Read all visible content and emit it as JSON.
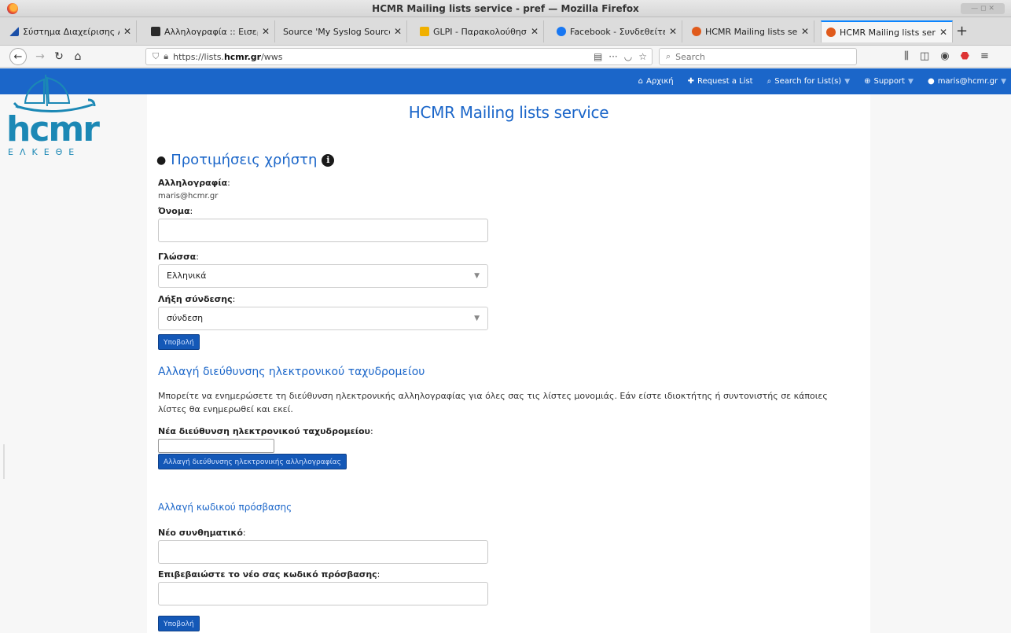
{
  "window": {
    "title": "HCMR Mailing lists service - pref — Mozilla Firefox"
  },
  "tabs": [
    {
      "label": "Σύστημα Διαχείρισης Ανθρώ",
      "fav_color": "#1b4fa8"
    },
    {
      "label": "Αλληλογραφία :: Εισερχόμενα",
      "fav_color": "#2b2b2b"
    },
    {
      "label": "Source 'My Syslog Source' :: Adis",
      "fav_color": "#888888"
    },
    {
      "label": "GLPI - Παρακολούθηση αιτήμ",
      "fav_color": "#f0b000"
    },
    {
      "label": "Facebook - Συνδεθείτε ή δημ",
      "fav_color": "#1877f2"
    },
    {
      "label": "HCMR Mailing lists service - p",
      "fav_color": "#e05a1b"
    },
    {
      "label": "HCMR Mailing lists service - p",
      "fav_color": "#e05a1b"
    }
  ],
  "navbar": {
    "url_prefix": "https://lists.",
    "url_host": "hcmr.gr",
    "url_path": "/wws",
    "search_placeholder": "Search"
  },
  "topnav": {
    "home": "Αρχική",
    "request": "Request a List",
    "search": "Search for List(s)",
    "support": "Support",
    "user": "maris@hcmr.gr"
  },
  "logo": {
    "word": "hcmr",
    "sub": "ΕΛΚΕΘΕ"
  },
  "site_title": "HCMR Mailing lists service",
  "prefs": {
    "heading": "Προτιμήσεις χρήστη",
    "email_label": "Αλληλογραφία",
    "email_value": "maris@hcmr.gr",
    "name_label": "Όνομα",
    "name_value": "",
    "language_label": "Γλώσσα",
    "language_value": "Ελληνικά",
    "session_label": "Λήξη σύνδεσης",
    "session_value": "σύνδεση",
    "submit": "Υποβολή"
  },
  "change_email": {
    "heading": "Αλλαγή διεύθυνσης ηλεκτρονικού ταχυδρομείου",
    "description": "Μπορείτε να ενημερώσετε τη διεύθυνση ηλεκτρονικής αλληλογραφίας για όλες σας τις λίστες μονομιάς. Εάν είστε ιδιοκτήτης ή συντονιστής σε κάποιες λίστες θα ενημερωθεί και εκεί.",
    "new_label": "Νέα διεύθυνση ηλεκτρονικού ταχυδρομείου",
    "button": "Αλλαγή διεύθυνσης ηλεκτρονικής αλληλογραφίας"
  },
  "change_password": {
    "heading": "Αλλαγή κωδικού πρόσβασης",
    "new_label": "Νέο συνθηματικό",
    "confirm_label": "Επιβεβαιώστε το νέο σας κωδικό πρόσβασης",
    "submit": "Υποβολή"
  }
}
